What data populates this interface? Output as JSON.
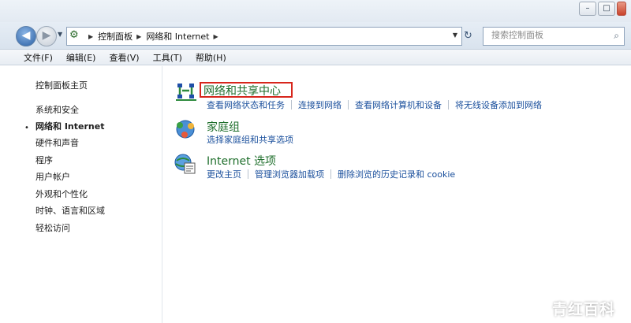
{
  "window": {
    "min_glyph": "–",
    "max_glyph": "□",
    "close_glyph": "×"
  },
  "navigation": {
    "back_glyph": "◀",
    "forward_glyph": "▶",
    "breadcrumbs": [
      "控制面板",
      "网络和 Internet"
    ],
    "refresh_glyph": "↻",
    "search_placeholder": "搜索控制面板",
    "icons": {
      "address": "control-panel-icon",
      "search": "search-icon"
    }
  },
  "menubar": {
    "items": [
      "文件(F)",
      "编辑(E)",
      "查看(V)",
      "工具(T)",
      "帮助(H)"
    ]
  },
  "sidebar": {
    "items": [
      {
        "label": "控制面板主页"
      },
      {
        "label": "系统和安全"
      },
      {
        "label": "网络和 Internet",
        "current": true
      },
      {
        "label": "硬件和声音"
      },
      {
        "label": "程序"
      },
      {
        "label": "用户帐户"
      },
      {
        "label": "外观和个性化"
      },
      {
        "label": "时钟、语言和区域"
      },
      {
        "label": "轻松访问"
      }
    ]
  },
  "main": {
    "sections": [
      {
        "title": "网络和共享中心",
        "icon": "network-sharing-icon",
        "tasks": [
          "查看网络状态和任务",
          "连接到网络",
          "查看网络计算机和设备",
          "将无线设备添加到网络"
        ]
      },
      {
        "title": "家庭组",
        "icon": "homegroup-icon",
        "tasks": [
          "选择家庭组和共享选项"
        ]
      },
      {
        "title": "Internet 选项",
        "icon": "internet-options-icon",
        "tasks": [
          "更改主页",
          "管理浏览器加载项",
          "删除浏览的历史记录和 cookie"
        ]
      }
    ],
    "highlight_color": "#d7261c"
  },
  "watermark": {
    "text": "青红百科"
  },
  "colors": {
    "link": "#1a4f9c",
    "section_title": "#1e6e2b",
    "highlight": "#d7261c"
  }
}
